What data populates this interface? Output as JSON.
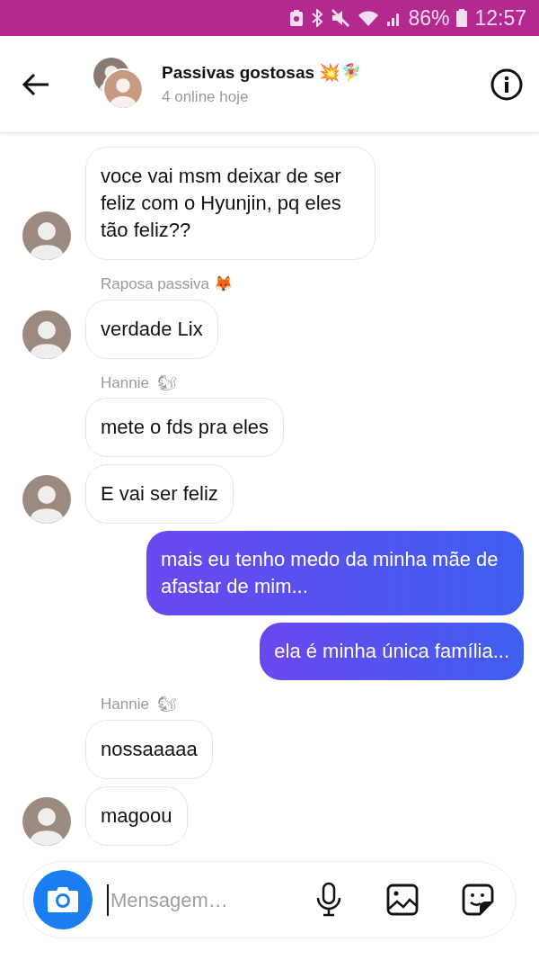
{
  "status_bar": {
    "battery": "86%",
    "time": "12:57"
  },
  "header": {
    "title": "Passivas gostosas 💥🧚‍♀️",
    "subtitle": "4 online hoje"
  },
  "messages": [
    {
      "kind": "incoming",
      "text": "voce vai msm deixar de ser feliz com o Hyunjin, pq eles tão feliz??",
      "avatar": true
    },
    {
      "kind": "sender",
      "text": "Raposa passiva 🦊"
    },
    {
      "kind": "incoming",
      "text": "verdade Lix",
      "avatar": true
    },
    {
      "kind": "sender",
      "text": "Hannie  🐿"
    },
    {
      "kind": "incoming",
      "text": "mete o fds pra eles",
      "avatar": false
    },
    {
      "kind": "incoming",
      "text": "E vai ser feliz",
      "avatar": true
    },
    {
      "kind": "outgoing",
      "text": "mais eu tenho medo da minha mãe de afastar de mim..."
    },
    {
      "kind": "outgoing",
      "text": "ela é minha única família..."
    },
    {
      "kind": "sender",
      "text": "Hannie  🐿"
    },
    {
      "kind": "incoming",
      "text": "nossaaaaa",
      "avatar": false
    },
    {
      "kind": "incoming",
      "text": "magoou",
      "avatar": true
    }
  ],
  "composer": {
    "placeholder": "Mensagem…"
  }
}
